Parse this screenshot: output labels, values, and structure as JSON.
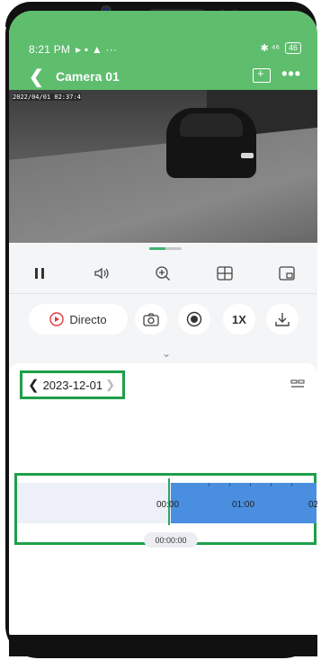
{
  "status_bar": {
    "time": "8:21 PM",
    "left_icons": "▸ ▪ ▲ ···",
    "right_icons": "✱ ⁴⁶",
    "battery": "46"
  },
  "header": {
    "title": "Camera 01"
  },
  "video": {
    "timestamp": "2022/04/01 02:37:4"
  },
  "action_row": {
    "live_label": "Directo",
    "speed_label": "1X"
  },
  "timeline": {
    "date": "2023-12-01",
    "hour_labels": [
      "00:00",
      "01:00",
      "02"
    ],
    "current_time": "00:00:00"
  },
  "colors": {
    "app_green": "#5fbd6e",
    "recording_blue": "#4a8fdf",
    "highlight_green": "#1ea04a"
  }
}
